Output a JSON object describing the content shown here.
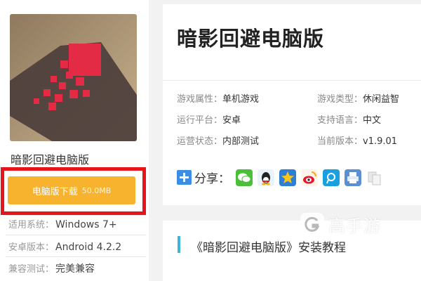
{
  "app": {
    "name": "暗影回避电脑版",
    "icon": "game-app-icon"
  },
  "download": {
    "label": "电脑版下载",
    "size": "50.0MB",
    "accent": "#f8b32e",
    "highlight": "#e8141b"
  },
  "specs": [
    {
      "label": "适用系统：",
      "value": "Windows 7+"
    },
    {
      "label": "安卓版本：",
      "value": "Android 4.2.2"
    },
    {
      "label": "兼容测试：",
      "value": "完美兼容"
    }
  ],
  "header": {
    "title": "暗影回避电脑版"
  },
  "attributes": [
    {
      "label": "游戏属性：",
      "value": "单机游戏"
    },
    {
      "label": "游戏类型：",
      "value": "休闲益智"
    },
    {
      "label": "运行平台：",
      "value": "安卓"
    },
    {
      "label": "支持语言：",
      "value": "中文"
    },
    {
      "label": "运营状态：",
      "value": "内部测试"
    },
    {
      "label": "当前版本：",
      "value": "v1.9.01"
    }
  ],
  "share": {
    "label": "分享：",
    "icons": [
      "wechat-icon",
      "qq-icon",
      "qzone-icon",
      "weibo-icon",
      "tencent-weibo-icon",
      "print-icon",
      "copy-icon"
    ]
  },
  "section": {
    "title": "《暗影回避电脑版》安装教程",
    "accent": "#39b6d8"
  },
  "watermark": {
    "text": "高手游"
  }
}
